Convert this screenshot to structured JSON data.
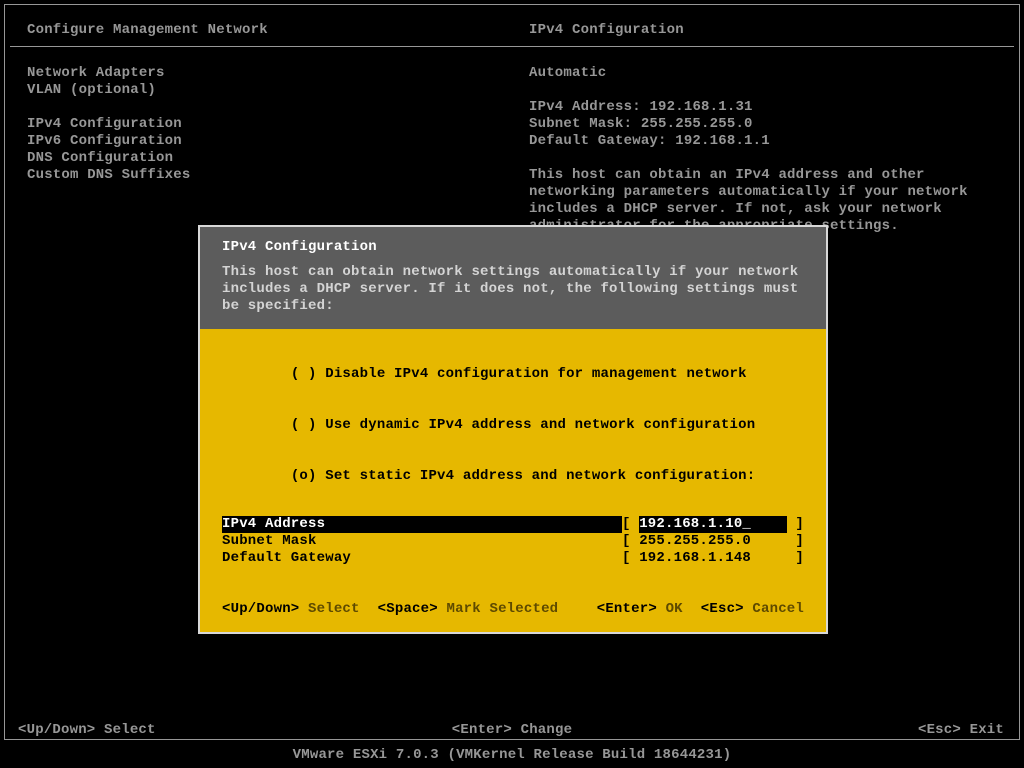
{
  "header": {
    "left": "Configure Management Network",
    "right": "IPv4 Configuration"
  },
  "menu": {
    "items": [
      "Network Adapters",
      "VLAN (optional)",
      "",
      "IPv4 Configuration",
      "IPv6 Configuration",
      "DNS Configuration",
      "Custom DNS Suffixes"
    ]
  },
  "info": {
    "mode": "Automatic",
    "ipv4_label": "IPv4 Address:",
    "ipv4_value": "192.168.1.31",
    "mask_label": "Subnet Mask:",
    "mask_value": "255.255.255.0",
    "gw_label": "Default Gateway:",
    "gw_value": "192.168.1.1",
    "desc": "This host can obtain an IPv4 address and other networking parameters automatically if your network includes a DHCP server. If not, ask your network administrator for the appropriate settings."
  },
  "dialog": {
    "title": "IPv4 Configuration",
    "intro": "This host can obtain network settings automatically if your network includes a DHCP server. If it does not, the following settings must be specified:",
    "options": [
      {
        "mark": "( )",
        "label": "Disable IPv4 configuration for management network"
      },
      {
        "mark": "( )",
        "label": "Use dynamic IPv4 address and network configuration"
      },
      {
        "mark": "(o)",
        "label": "Set static IPv4 address and network configuration:"
      }
    ],
    "fields": [
      {
        "label": "IPv4 Address",
        "value": "192.168.1.10_",
        "selected": true
      },
      {
        "label": "Subnet Mask",
        "value": "255.255.255.0",
        "selected": false
      },
      {
        "label": "Default Gateway",
        "value": "192.168.1.148",
        "selected": false
      }
    ],
    "footer": {
      "updown_k": "<Up/Down>",
      "updown_a": "Select",
      "space_k": "<Space>",
      "space_a": "Mark Selected",
      "enter_k": "<Enter>",
      "enter_a": "OK",
      "esc_k": "<Esc>",
      "esc_a": "Cancel"
    }
  },
  "statusbar": {
    "left_k": "<Up/Down>",
    "left_a": "Select",
    "mid_k": "<Enter>",
    "mid_a": "Change",
    "right_k": "<Esc>",
    "right_a": "Exit"
  },
  "brand": "VMware ESXi 7.0.3 (VMKernel Release Build 18644231)"
}
